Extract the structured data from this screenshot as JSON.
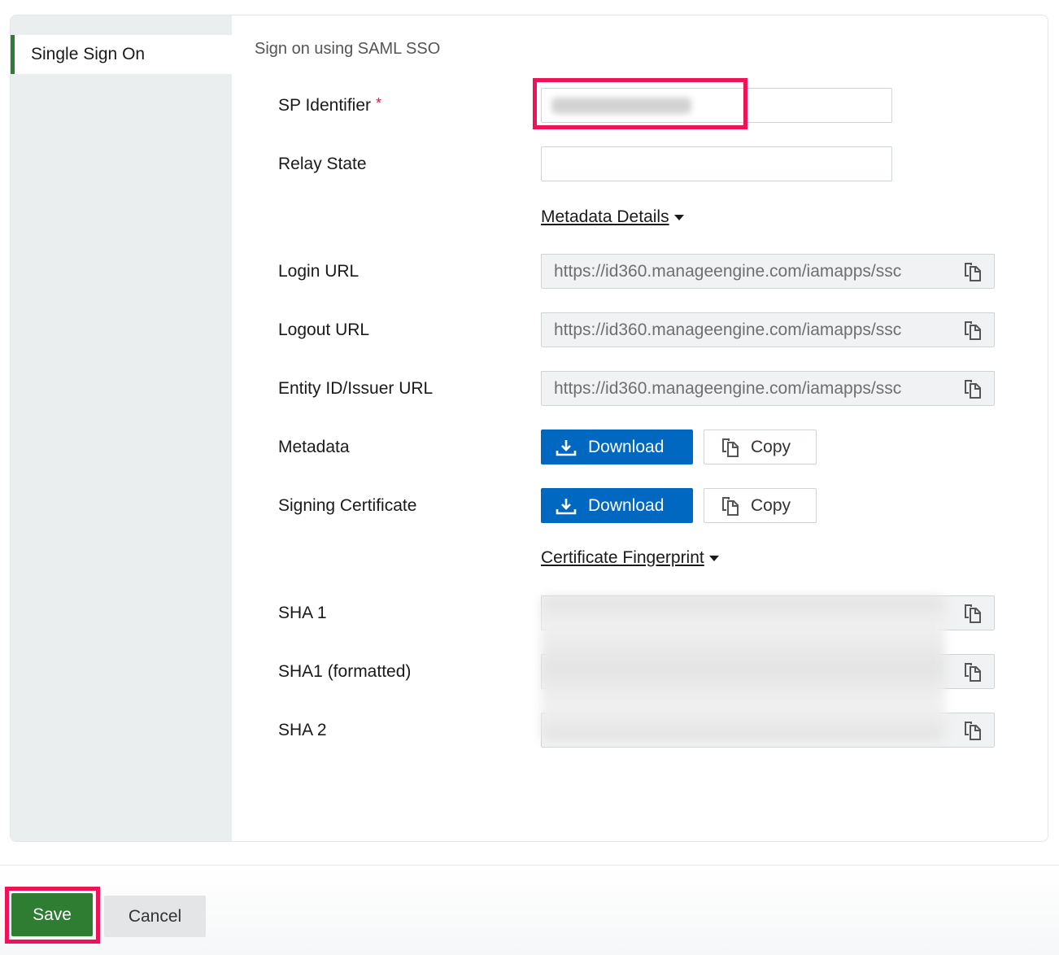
{
  "sidebar": {
    "items": [
      {
        "label": "Single Sign On",
        "active": true
      }
    ]
  },
  "main": {
    "section_title": "Sign on using SAML SSO",
    "sp_identifier": {
      "label": "SP Identifier",
      "required_mark": "*"
    },
    "relay_state": {
      "label": "Relay State",
      "value": ""
    },
    "metadata_details_link": "Metadata Details ",
    "login_url": {
      "label": "Login URL",
      "value": "https://id360.manageengine.com/iamapps/ssc"
    },
    "logout_url": {
      "label": "Logout URL",
      "value": "https://id360.manageengine.com/iamapps/ssc"
    },
    "entity_id": {
      "label": "Entity ID/Issuer URL",
      "value": "https://id360.manageengine.com/iamapps/ssc"
    },
    "metadata": {
      "label": "Metadata",
      "download_label": "Download",
      "copy_label": "Copy"
    },
    "signing_certificate": {
      "label": "Signing Certificate",
      "download_label": "Download",
      "copy_label": "Copy"
    },
    "certificate_fingerprint_link": "Certificate Fingerprint ",
    "sha1": {
      "label": "SHA 1"
    },
    "sha1_formatted": {
      "label": "SHA1 (formatted)"
    },
    "sha2": {
      "label": "SHA 2"
    }
  },
  "footer": {
    "save_label": "Save",
    "cancel_label": "Cancel"
  },
  "colors": {
    "accent_green": "#2e7d32",
    "primary_blue": "#0068c0",
    "highlight_pink": "#ee1259",
    "required_red": "#e0174b"
  },
  "icons": {
    "copy": "copy-icon",
    "download": "download-icon",
    "caret": "caret-down-icon"
  }
}
